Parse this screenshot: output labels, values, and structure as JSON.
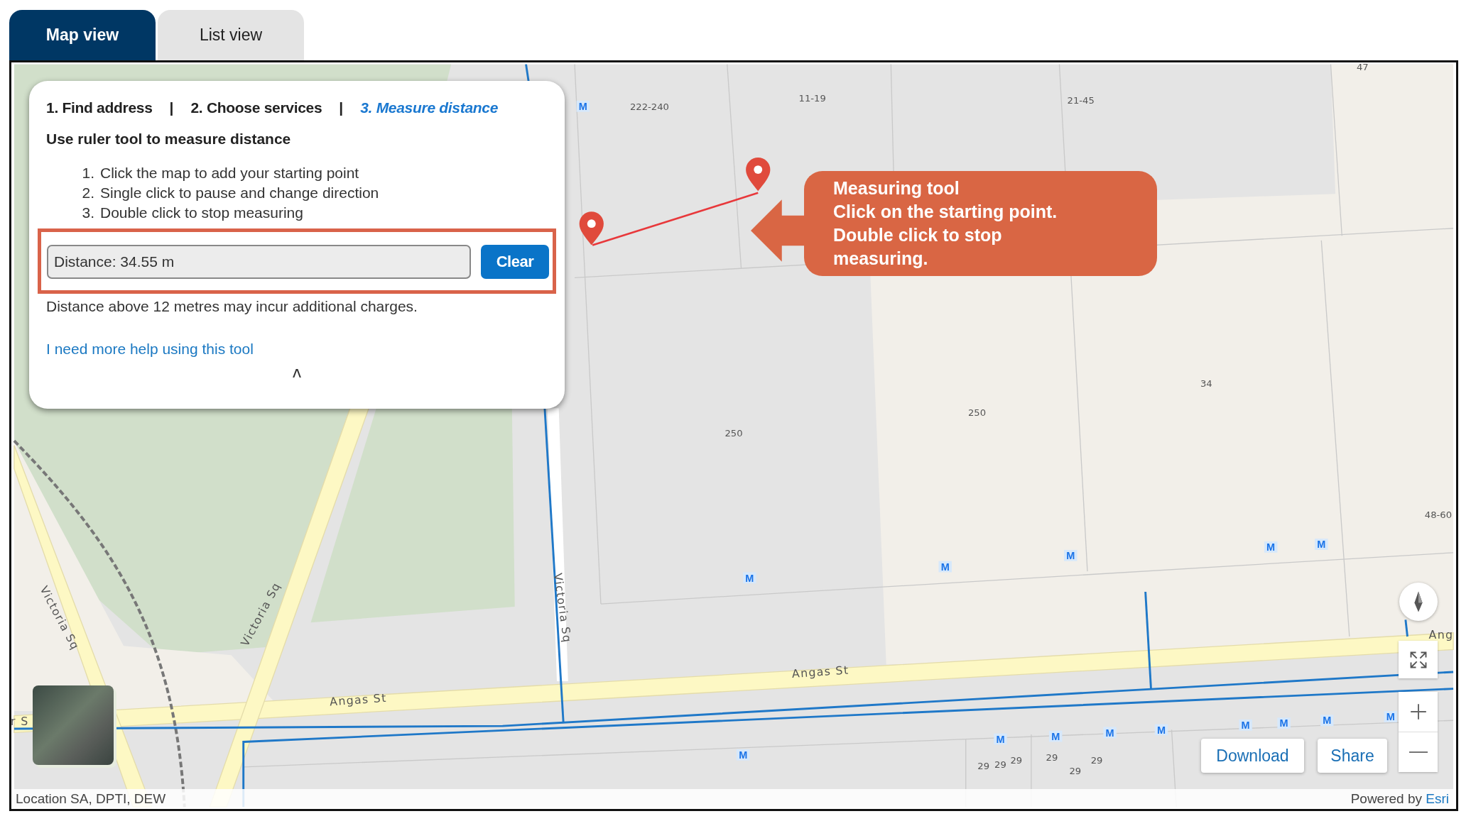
{
  "tabs": [
    {
      "label": "Map view",
      "selected": true
    },
    {
      "label": "List view",
      "selected": false
    }
  ],
  "panel": {
    "steps": [
      {
        "label": "1. Find address",
        "selected": false
      },
      {
        "label": "2. Choose services",
        "selected": false
      },
      {
        "label": "3. Measure distance",
        "selected": true
      }
    ],
    "step_separators": [
      "|",
      "|"
    ],
    "heading": "Use ruler tool to measure distance",
    "instructions": [
      {
        "number": "1.",
        "text": "Click the map to add your starting point"
      },
      {
        "number": "2.",
        "text": "Single click to pause and change direction"
      },
      {
        "number": "3.",
        "text": "Double click to stop measuring"
      }
    ],
    "distance_field": {
      "value": "Distance: 34.55 m"
    },
    "clear_button": "Clear",
    "note": "Distance above 12 metres may incur additional charges.",
    "help_link": "I need more help using this tool",
    "collapse_toggle": "ʌ"
  },
  "callout": {
    "lines": [
      "Measuring tool",
      "Click on the starting point.",
      "Double click to stop measuring."
    ]
  },
  "map": {
    "labels": [
      {
        "text": "222-240",
        "kind": "parcel"
      },
      {
        "text": "11-19",
        "kind": "parcel"
      },
      {
        "text": "21-45",
        "kind": "parcel"
      },
      {
        "text": "47",
        "kind": "parcel"
      },
      {
        "text": "250",
        "kind": "parcel"
      },
      {
        "text": "250",
        "kind": "parcel"
      },
      {
        "text": "34",
        "kind": "parcel"
      },
      {
        "text": "48-60",
        "kind": "parcel"
      },
      {
        "text": "29",
        "kind": "parcel"
      },
      {
        "text": "29",
        "kind": "parcel"
      },
      {
        "text": "29",
        "kind": "parcel"
      },
      {
        "text": "29",
        "kind": "parcel"
      },
      {
        "text": "29",
        "kind": "parcel"
      },
      {
        "text": "29",
        "kind": "parcel"
      },
      {
        "text": "Victoria Sq",
        "kind": "street"
      },
      {
        "text": "Victoria Sq",
        "kind": "street"
      },
      {
        "text": "Victoria Sq",
        "kind": "street"
      },
      {
        "text": "Angas St",
        "kind": "street"
      },
      {
        "text": "Angas St",
        "kind": "street"
      },
      {
        "text": "Ang",
        "kind": "street"
      },
      {
        "text": "r S",
        "kind": "street"
      }
    ],
    "markers": [
      "M",
      "M",
      "M",
      "M",
      "M",
      "M",
      "M",
      "M",
      "M",
      "M",
      "M",
      "M",
      "M",
      "M",
      "M"
    ]
  },
  "map_buttons": {
    "download": "Download",
    "share": "Share"
  },
  "attribution": {
    "sources": "Location SA, DPTI, DEW",
    "powered_by": "Powered by",
    "provider_link": "Esri"
  }
}
